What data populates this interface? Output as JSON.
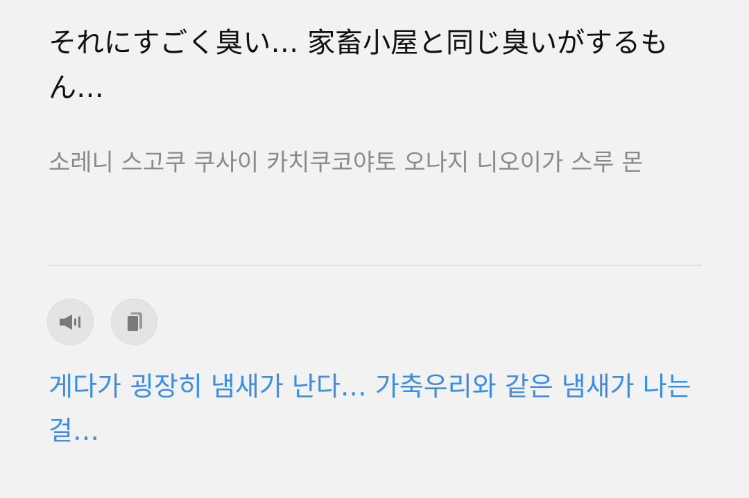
{
  "source": {
    "text": "それにすごく臭い… 家畜小屋と同じ臭いがするもん…"
  },
  "pronunciation": {
    "text": "소레니 스고쿠 쿠사이 카치쿠코야토 오나지 니오이가 스루 몬"
  },
  "actions": {
    "listen_icon": "speaker-icon",
    "copy_icon": "copy-icon"
  },
  "translation": {
    "text": "게다가 굉장히 냄새가 난다… 가축우리와 같은 냄새가 나는걸…"
  },
  "colors": {
    "background": "#f2f2f2",
    "source_text": "#111111",
    "pronunciation_text": "#8a8a8a",
    "translation_text": "#3a8ee6",
    "icon": "#7a7a7a"
  }
}
